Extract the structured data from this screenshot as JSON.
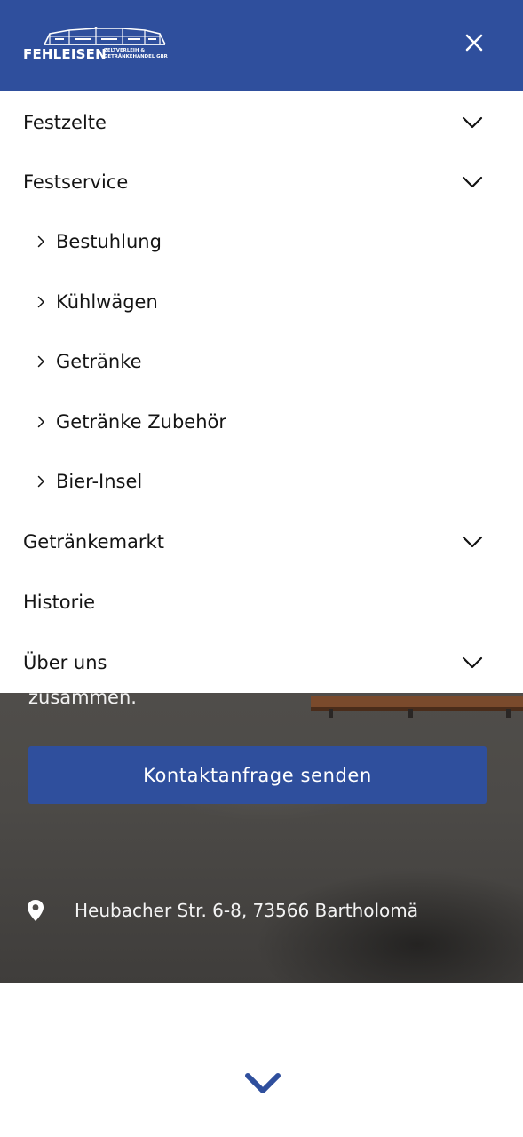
{
  "colors": {
    "brand": "#2f4f9d",
    "menu_text": "#141414",
    "hero_text": "#f2f2f2"
  },
  "header": {
    "logo_name": "FEHLEISEN",
    "logo_subtitle_line1": "ZELTVERLEIH &",
    "logo_subtitle_line2": "GETRÄNKEHANDEL GBR",
    "close_icon": "close-icon"
  },
  "menu": {
    "items": [
      {
        "label": "Festzelte",
        "icon": "chevron-down-icon"
      },
      {
        "label": "Festservice",
        "icon": "chevron-down-icon"
      },
      {
        "label": "Getränkemarkt",
        "icon": "chevron-down-icon"
      },
      {
        "label": "Historie"
      },
      {
        "label": "Über uns",
        "icon": "chevron-down-icon"
      }
    ],
    "festservice_submenu": [
      {
        "label": "Bestuhlung",
        "icon": "chevron-right-icon"
      },
      {
        "label": "Kühlwägen",
        "icon": "chevron-right-icon"
      },
      {
        "label": "Getränke",
        "icon": "chevron-right-icon"
      },
      {
        "label": "Getränke Zubehör",
        "icon": "chevron-right-icon"
      },
      {
        "label": "Bier-Insel",
        "icon": "chevron-right-icon"
      }
    ]
  },
  "hero": {
    "partial_text": "zusammen.",
    "contact_button_label": "Kontaktanfrage senden",
    "address": "Heubacher Str. 6-8, 73566 Bartholomä",
    "address_icon": "map-pin-icon"
  },
  "footer": {
    "scroll_icon": "chevron-down-icon"
  }
}
